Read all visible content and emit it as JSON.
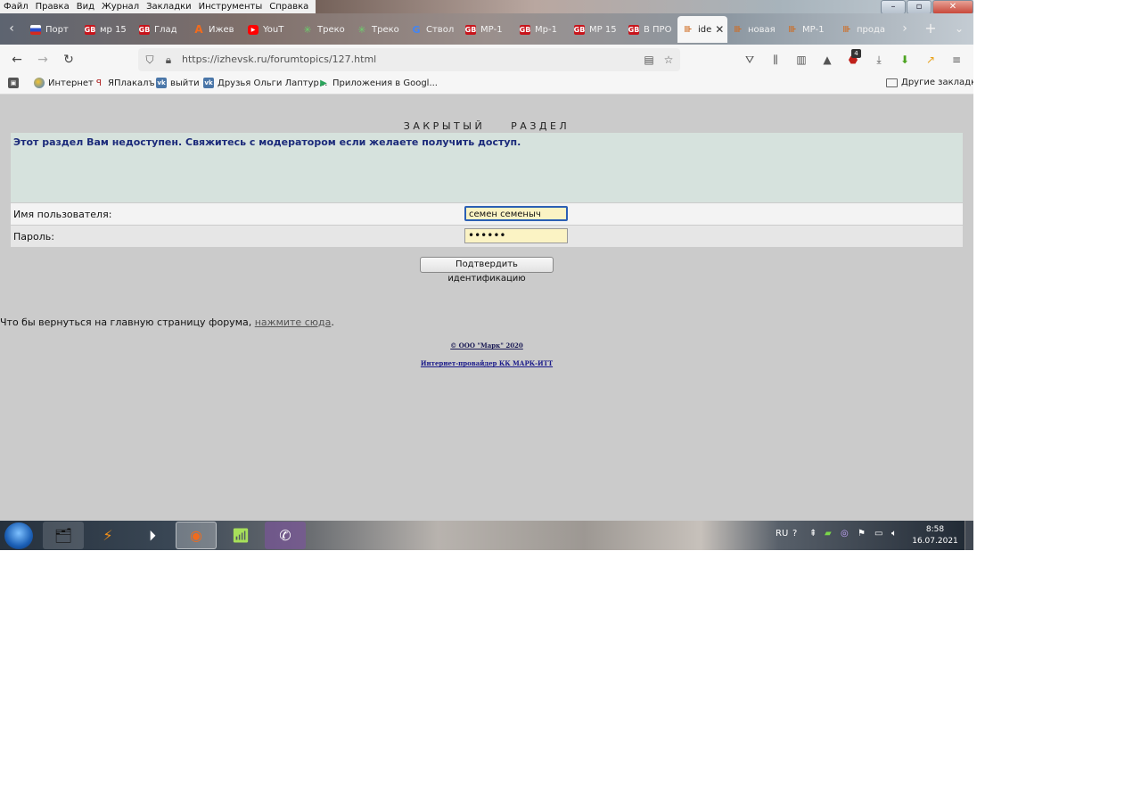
{
  "menu": [
    "Файл",
    "Правка",
    "Вид",
    "Журнал",
    "Закладки",
    "Инструменты",
    "Справка"
  ],
  "tabs": [
    {
      "title": "Порт",
      "icon": "ru"
    },
    {
      "title": "мр 15",
      "icon": "gb"
    },
    {
      "title": "Глад",
      "icon": "gb"
    },
    {
      "title": "Ижев",
      "icon": "a"
    },
    {
      "title": "YouT",
      "icon": "yt"
    },
    {
      "title": "Треко",
      "icon": "tr"
    },
    {
      "title": "Треко",
      "icon": "tr"
    },
    {
      "title": "Ствол",
      "icon": "g"
    },
    {
      "title": "МР-1",
      "icon": "gb"
    },
    {
      "title": "Мр-1",
      "icon": "gb"
    },
    {
      "title": "МР 15",
      "icon": "gb"
    },
    {
      "title": "В ПРО",
      "icon": "gb"
    },
    {
      "title": "ide",
      "icon": "iz",
      "active": true
    },
    {
      "title": "новая",
      "icon": "iz"
    },
    {
      "title": "МР-1",
      "icon": "iz"
    },
    {
      "title": "прода",
      "icon": "iz"
    }
  ],
  "navbar": {
    "url": "https://izhevsk.ru/forumtopics/127.html",
    "badge_count": "4"
  },
  "bookmarks": [
    {
      "label": "Интернет",
      "icon": "globe"
    },
    {
      "label": "ЯПлакалъ",
      "icon": "yp"
    },
    {
      "label": "выйти",
      "icon": "vk"
    },
    {
      "label": "Друзья Ольги Лаптур...",
      "icon": "vk"
    },
    {
      "label": "Приложения в Googl...",
      "icon": "gp"
    }
  ],
  "other_bookmarks": "Другие закладки",
  "page": {
    "closed_title": "ЗАКРЫТЫЙ РАЗДЕЛ",
    "message": "Этот раздел Вам недоступен. Свяжитесь с модератором если желаете получить доступ.",
    "username_label": "Имя пользователя:",
    "username_value": "семен семеныч",
    "password_label": "Пароль:",
    "password_value": "••••••",
    "submit_label": "Подтвердить идентификацию",
    "back_text": "Что бы вернуться на главную страницу форума,",
    "back_link": "нажмите сюда",
    "back_period": ".",
    "copyright": "© ООО \"Марк\" 2020",
    "isp": "Интернет-провайдер КК МАРК-ИТТ"
  },
  "taskbar": {
    "lang": "RU",
    "time": "8:58",
    "date": "16.07.2021"
  }
}
